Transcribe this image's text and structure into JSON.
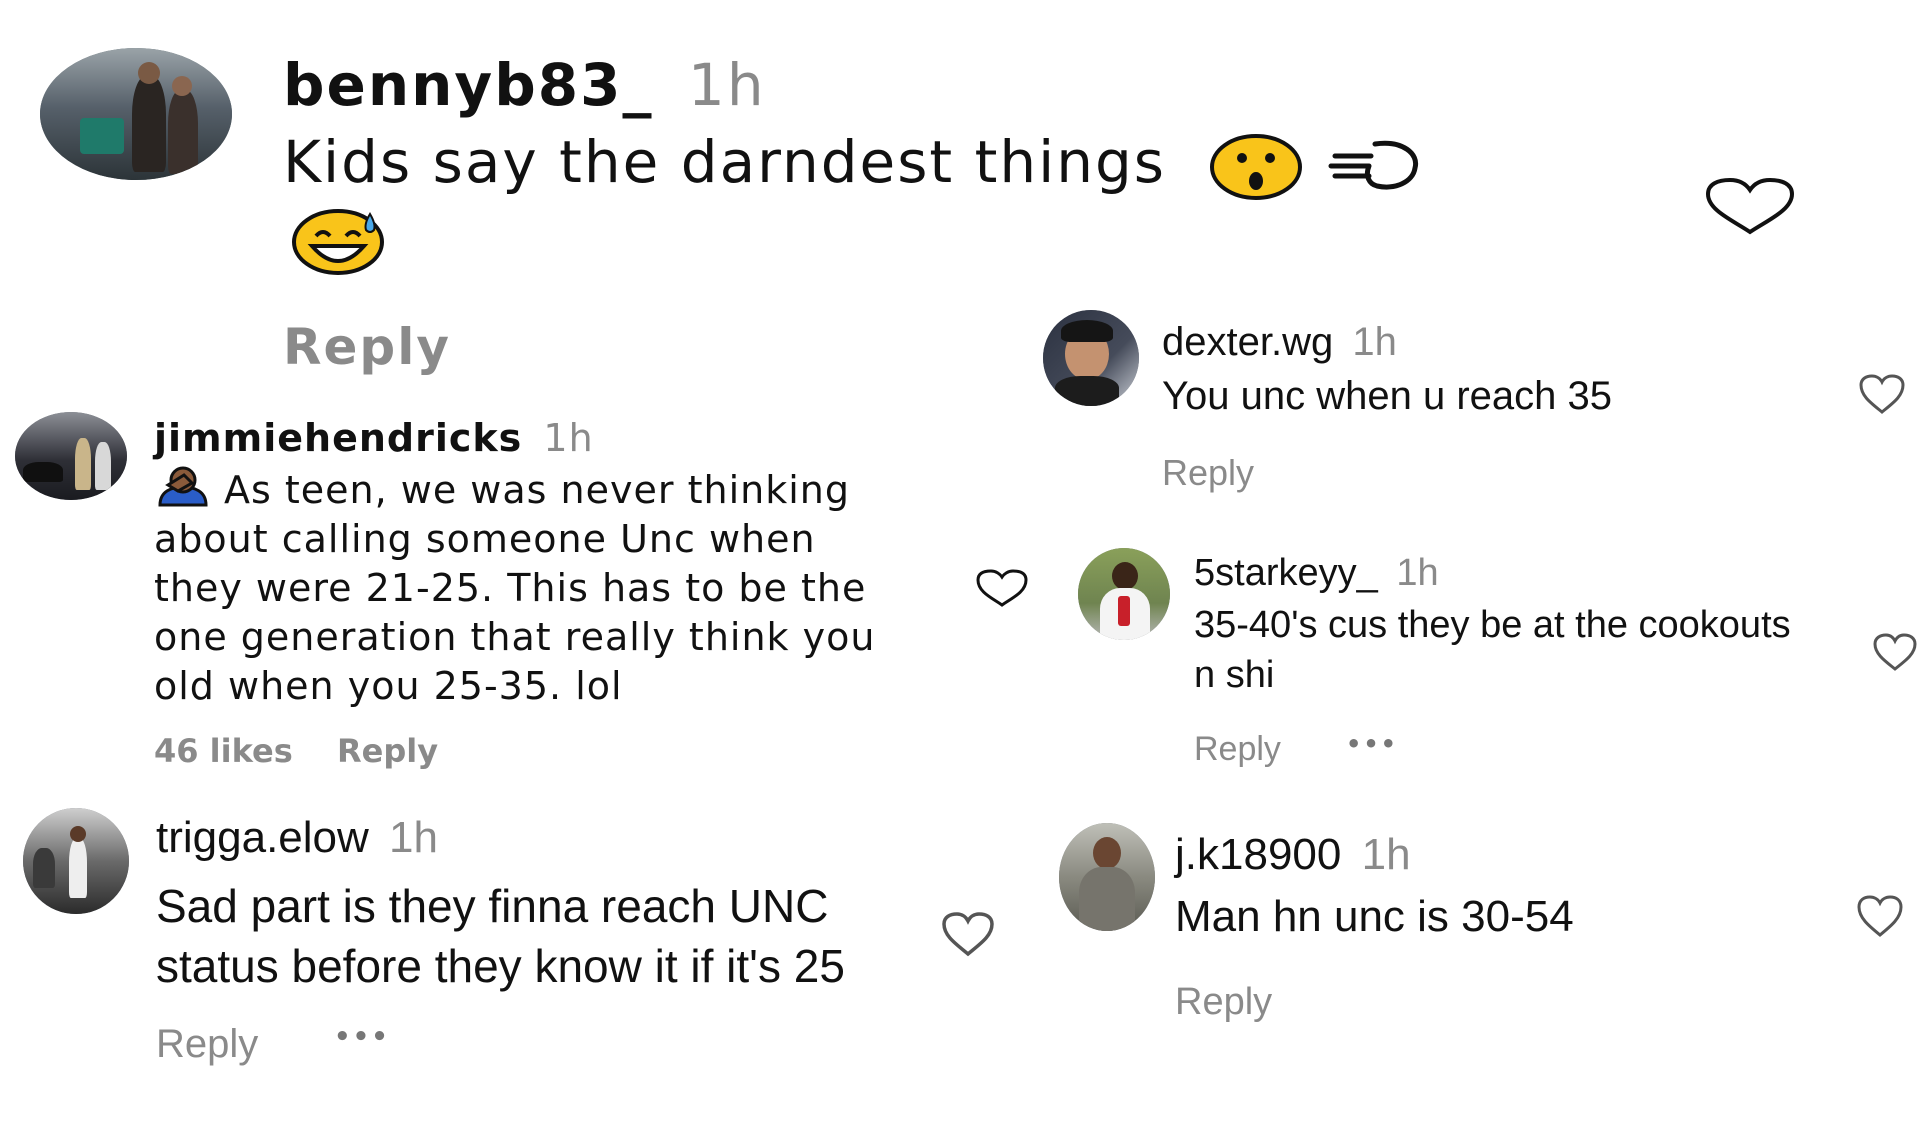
{
  "comments": [
    {
      "username": "bennyb83_",
      "time": "1h",
      "text": "Kids say the darndest things",
      "emojis": [
        "hushed-face-emoji",
        "dashing-away-emoji",
        "grinning-sweat-emoji"
      ],
      "reply_label": "Reply"
    },
    {
      "username": "jimmiehendricks",
      "time": "1h",
      "text_lines": [
        "As teen, we was never thinking",
        "about calling someone Unc when",
        "they were 21-25. This has to be the",
        "one generation that really think you",
        "old when you 25-35. lol"
      ],
      "leading_emoji": "facepalm-emoji",
      "likes": "46 likes",
      "reply_label": "Reply"
    },
    {
      "username": "trigga.elow",
      "time": "1h",
      "text_lines": [
        "Sad part is they finna reach UNC",
        "status before they know it if it's 25"
      ],
      "reply_label": "Reply",
      "more": "•••"
    },
    {
      "username": "dexter.wg",
      "time": "1h",
      "text": "You unc when u reach 35",
      "reply_label": "Reply"
    },
    {
      "username": "5starkeyy_",
      "time": "1h",
      "text_lines": [
        "35-40's cus they be at the cookouts",
        "n shi"
      ],
      "reply_label": "Reply",
      "more": "•••"
    },
    {
      "username": "j.k18900",
      "time": "1h",
      "text": "Man hn unc is 30-54",
      "reply_label": "Reply"
    }
  ],
  "icons": {
    "like": "heart-outline-icon",
    "more": "more-options-icon"
  },
  "colors": {
    "text": "#111111",
    "meta": "#8a8a8a",
    "emoji_yellow": "#f9c41a"
  }
}
